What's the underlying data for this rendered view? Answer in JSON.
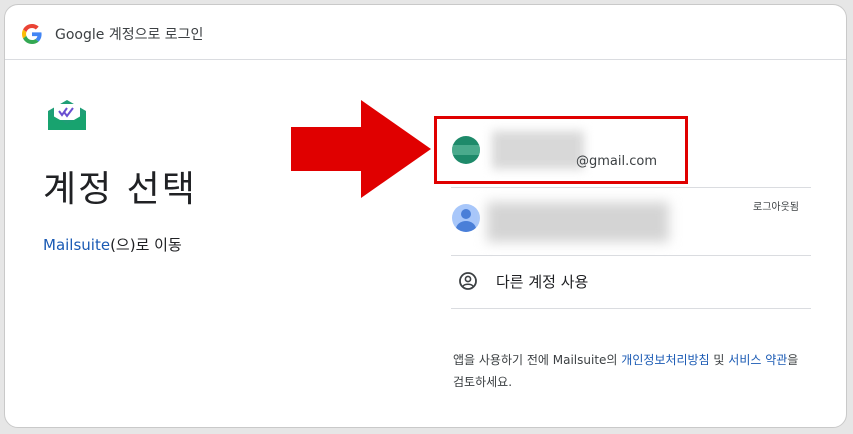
{
  "header": {
    "title": "Google 계정으로 로그인",
    "logo_icon": "google-g-icon"
  },
  "left": {
    "app_logo_icon": "mailsuite-envelope-icon",
    "heading": "계정 선택",
    "continue_app": "Mailsuite",
    "continue_suffix": "(으)로 이동"
  },
  "accounts": [
    {
      "email_suffix": "@gmail.com",
      "avatar_color": "#1e8a6a",
      "highlighted": true,
      "highlight_color": "#e00000"
    },
    {
      "status": "로그아웃됨",
      "avatar_icon": "default-person-icon"
    }
  ],
  "other_account": {
    "label": "다른 계정 사용",
    "icon": "account-circle-icon"
  },
  "disclaimer": {
    "part1": "앱을 사용하기 전에 Mailsuite의 ",
    "privacy_link": "개인정보처리방침",
    "part2": " 및 ",
    "terms_link": "서비스 약관",
    "part3": "을 검토하세요."
  },
  "annotation": {
    "arrow_icon": "red-arrow-icon",
    "color": "#e00000"
  }
}
